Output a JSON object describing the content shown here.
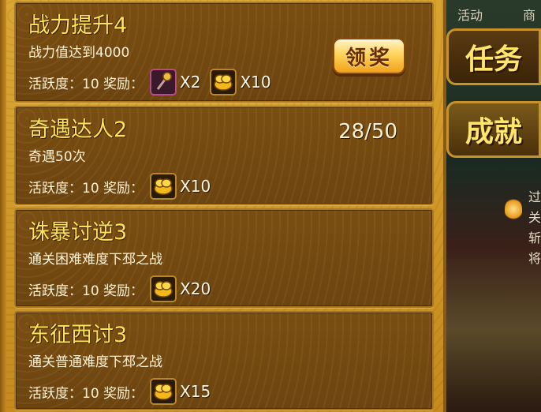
{
  "tasks": [
    {
      "title": "战力提升4",
      "desc": "战力值达到4000",
      "reward_prefix": "活跃度：10 奖励：",
      "rewards": [
        {
          "icon": "staff-icon",
          "count": "X2"
        },
        {
          "icon": "gold-ingot-icon",
          "count": "X10"
        }
      ],
      "action_label": "领奖"
    },
    {
      "title": "奇遇达人2",
      "desc": "奇遇50次",
      "progress": "28/50",
      "reward_prefix": "活跃度：10 奖励：",
      "rewards": [
        {
          "icon": "gold-ingot-icon",
          "count": "X10"
        }
      ]
    },
    {
      "title": "诛暴讨逆3",
      "desc": "通关困难难度下邳之战",
      "reward_prefix": "活跃度：10 奖励：",
      "rewards": [
        {
          "icon": "gold-ingot-icon",
          "count": "X20"
        }
      ]
    },
    {
      "title": "东征西讨3",
      "desc": "通关普通难度下邳之战",
      "reward_prefix": "活跃度：10 奖励：",
      "rewards": [
        {
          "icon": "gold-ingot-icon",
          "count": "X15"
        }
      ]
    }
  ],
  "side_tabs": {
    "tasks": "任务",
    "achievements": "成就"
  },
  "scene": {
    "top_left_label": "活动",
    "top_right_label": "商",
    "side_glyphs": [
      "过",
      "关",
      "斩",
      "将"
    ]
  },
  "colors": {
    "title": "#ffe35a",
    "panel": "#d9a42e",
    "card": "#7a4e12",
    "button": "#ffd35a"
  }
}
